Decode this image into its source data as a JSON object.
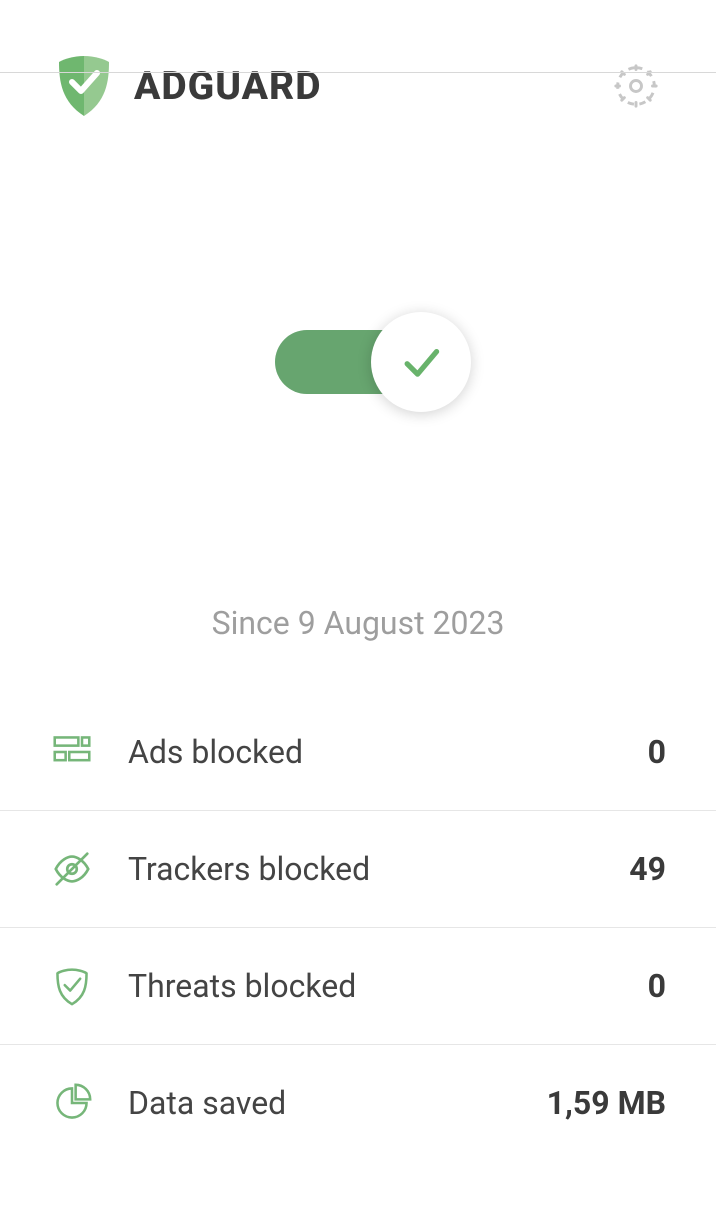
{
  "brand": "ADGUARD",
  "since_label": "Since 9 August 2023",
  "stats": {
    "ads_blocked": {
      "label": "Ads blocked",
      "value": "0"
    },
    "trackers_blocked": {
      "label": "Trackers blocked",
      "value": "49"
    },
    "threats_blocked": {
      "label": "Threats blocked",
      "value": "0"
    },
    "data_saved": {
      "label": "Data saved",
      "value": "1,59 MB"
    }
  },
  "colors": {
    "accent": "#68b36b",
    "accent_dark": "#67a56f",
    "gray_text": "#9e9e9e"
  }
}
